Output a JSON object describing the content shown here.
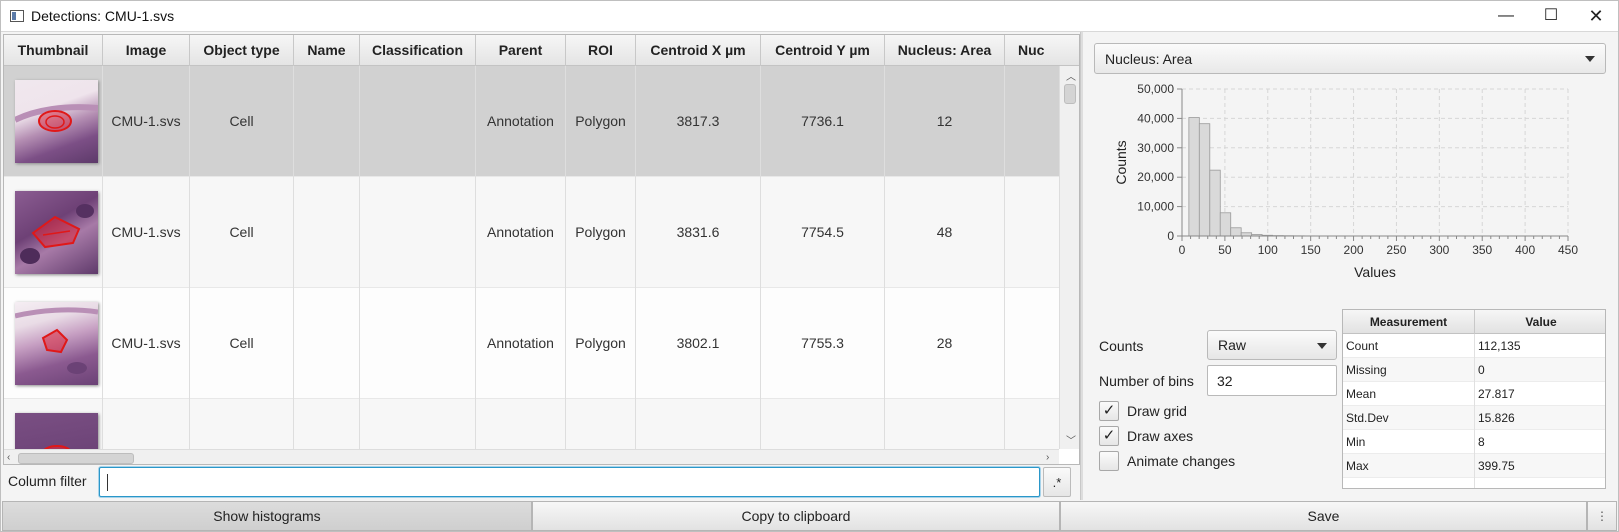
{
  "window": {
    "title": "Detections: CMU-1.svs",
    "min_label": "—",
    "max_label": "☐",
    "close_label": "✕"
  },
  "table": {
    "columns": [
      "Thumbnail",
      "Image",
      "Object type",
      "Name",
      "Classification",
      "Parent",
      "ROI",
      "Centroid X µm",
      "Centroid Y µm",
      "Nucleus: Area",
      "Nuc"
    ],
    "rows": [
      {
        "image": "CMU-1.svs",
        "object_type": "Cell",
        "name": "",
        "classification": "",
        "parent": "Annotation",
        "roi": "Polygon",
        "cx": "3817.3",
        "cy": "7736.1",
        "area": "12"
      },
      {
        "image": "CMU-1.svs",
        "object_type": "Cell",
        "name": "",
        "classification": "",
        "parent": "Annotation",
        "roi": "Polygon",
        "cx": "3831.6",
        "cy": "7754.5",
        "area": "48"
      },
      {
        "image": "CMU-1.svs",
        "object_type": "Cell",
        "name": "",
        "classification": "",
        "parent": "Annotation",
        "roi": "Polygon",
        "cx": "3802.1",
        "cy": "7755.3",
        "area": "28"
      }
    ]
  },
  "filter": {
    "label": "Column filter",
    "value": "",
    "regex_label": ".*"
  },
  "buttons": {
    "show_histograms": "Show histograms",
    "copy": "Copy to clipboard",
    "save": "Save",
    "more": "⋮"
  },
  "histogram": {
    "measurement": "Nucleus: Area",
    "counts_label": "Counts",
    "counts_value": "Raw",
    "bins_label": "Number of bins",
    "bins_value": "32",
    "draw_grid_label": "Draw grid",
    "draw_grid": true,
    "draw_axes_label": "Draw axes",
    "draw_axes": true,
    "animate_label": "Animate changes",
    "animate": false
  },
  "chart_data": {
    "type": "bar",
    "xlabel": "Values",
    "ylabel": "Counts",
    "xlim": [
      0,
      450
    ],
    "ylim": [
      0,
      50000
    ],
    "xticks": [
      0,
      50,
      100,
      150,
      200,
      250,
      300,
      350,
      400,
      450
    ],
    "yticks": [
      "0",
      "10,000",
      "20,000",
      "30,000",
      "40,000",
      "50,000"
    ],
    "bin_start": 8,
    "bin_width": 12.2,
    "values": [
      40300,
      38200,
      22400,
      7900,
      2800,
      1100,
      500,
      250,
      140,
      90,
      60,
      40,
      30,
      20,
      15,
      12,
      10,
      8,
      6,
      5,
      4,
      3,
      3,
      2,
      2,
      1,
      1,
      1,
      1,
      1,
      1,
      1
    ],
    "grid": true
  },
  "stats": {
    "headers": [
      "Measurement",
      "Value"
    ],
    "rows": [
      [
        "Count",
        "112,135"
      ],
      [
        "Missing",
        "0"
      ],
      [
        "Mean",
        "27.817"
      ],
      [
        "Std.Dev",
        "15.826"
      ],
      [
        "Min",
        "8"
      ],
      [
        "Max",
        "399.75"
      ]
    ]
  }
}
